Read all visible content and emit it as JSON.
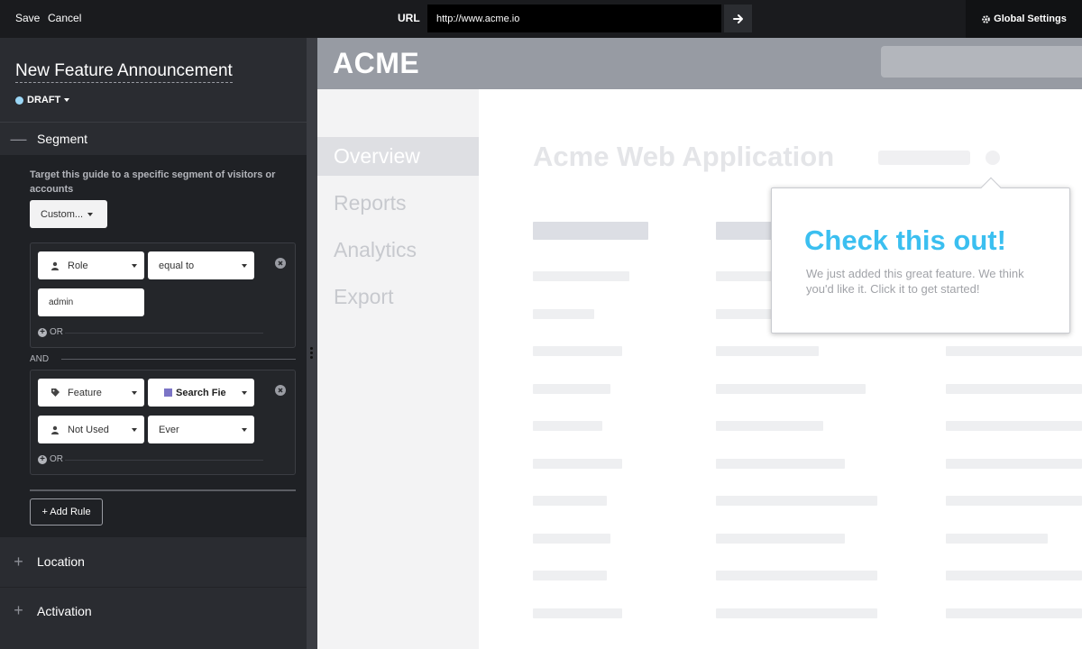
{
  "topbar": {
    "save_label": "Save",
    "cancel_label": "Cancel",
    "url_label": "URL",
    "url_value": "http://www.acme.io",
    "go_icon": "arrow-right-icon",
    "global_settings_label": "Global Settings",
    "global_settings_icon": "gear-icon"
  },
  "guide": {
    "title": "New Feature Announcement",
    "status": "DRAFT",
    "status_color": "#9bd7f6"
  },
  "segment": {
    "header": "Segment",
    "description": "Target this guide to a specific segment of visitors or accounts",
    "custom_button": "Custom...",
    "rule1": {
      "field": "Role",
      "field_icon": "person-icon",
      "operator": "equal to",
      "value": "admin",
      "or_label": "OR"
    },
    "and_label": "AND",
    "rule2": {
      "field": "Feature",
      "field_icon": "tag-icon",
      "value": "Search Fie",
      "value_swatch_color": "#7b74c6",
      "field2": "Not Used",
      "field2_icon": "person-icon",
      "value2": "Ever",
      "or_label": "OR"
    },
    "add_rule_label": "+ Add Rule"
  },
  "sections": {
    "location": "Location",
    "activation": "Activation"
  },
  "preview": {
    "logo": "ACME",
    "nav": [
      "Overview",
      "Reports",
      "Analytics",
      "Export"
    ],
    "active_nav": "Overview",
    "app_title": "Acme Web Application",
    "tooltip": {
      "title": "Check this out!",
      "body": "We just added this great feature. We think you'd like it. Click it to get started!",
      "title_color": "#3bbff0"
    }
  }
}
